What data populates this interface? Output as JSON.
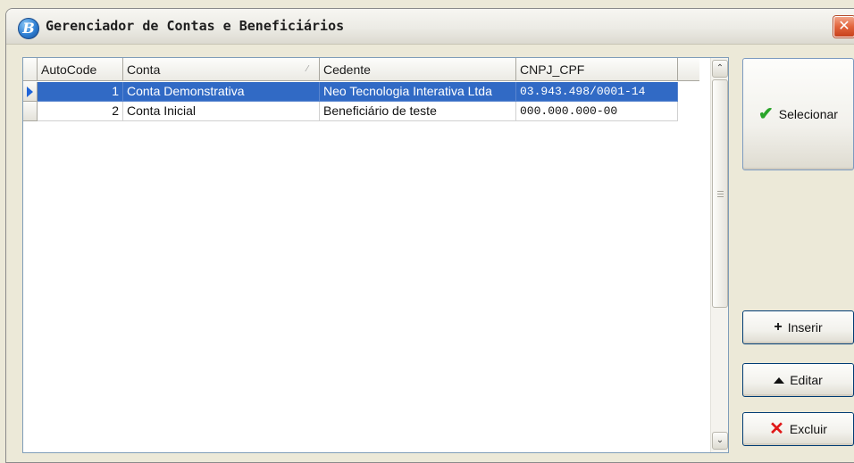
{
  "window": {
    "title": "Gerenciador de Contas e Beneficiários",
    "icon": "app-logo-icon",
    "icon_letter": "B",
    "close_symbol": "✕"
  },
  "grid": {
    "columns": [
      "AutoCode",
      "Conta",
      "Cedente",
      "CNPJ_CPF"
    ],
    "sort_indicator": "⁄",
    "rows": [
      {
        "autocode": "1",
        "conta": "Conta Demonstrativa",
        "cedente": "Neo Tecnologia Interativa Ltda",
        "cnpj_cpf": "03.943.498/0001-14",
        "selected": true
      },
      {
        "autocode": "2",
        "conta": "Conta Inicial",
        "cedente": "Beneficiário de teste",
        "cnpj_cpf": "000.000.000-00",
        "selected": false
      }
    ],
    "scroll": {
      "up": "⌃",
      "down": "⌄"
    }
  },
  "buttons": {
    "select_label": "Selecionar",
    "insert_label": "Inserir",
    "edit_label": "Editar",
    "delete_label": "Excluir",
    "check_symbol": "✔",
    "plus_symbol": "+",
    "x_symbol": "✕"
  },
  "colors": {
    "selection": "#316ac5",
    "window_bg": "#ece9d8",
    "indicator_arrow": "#1f64d8"
  }
}
